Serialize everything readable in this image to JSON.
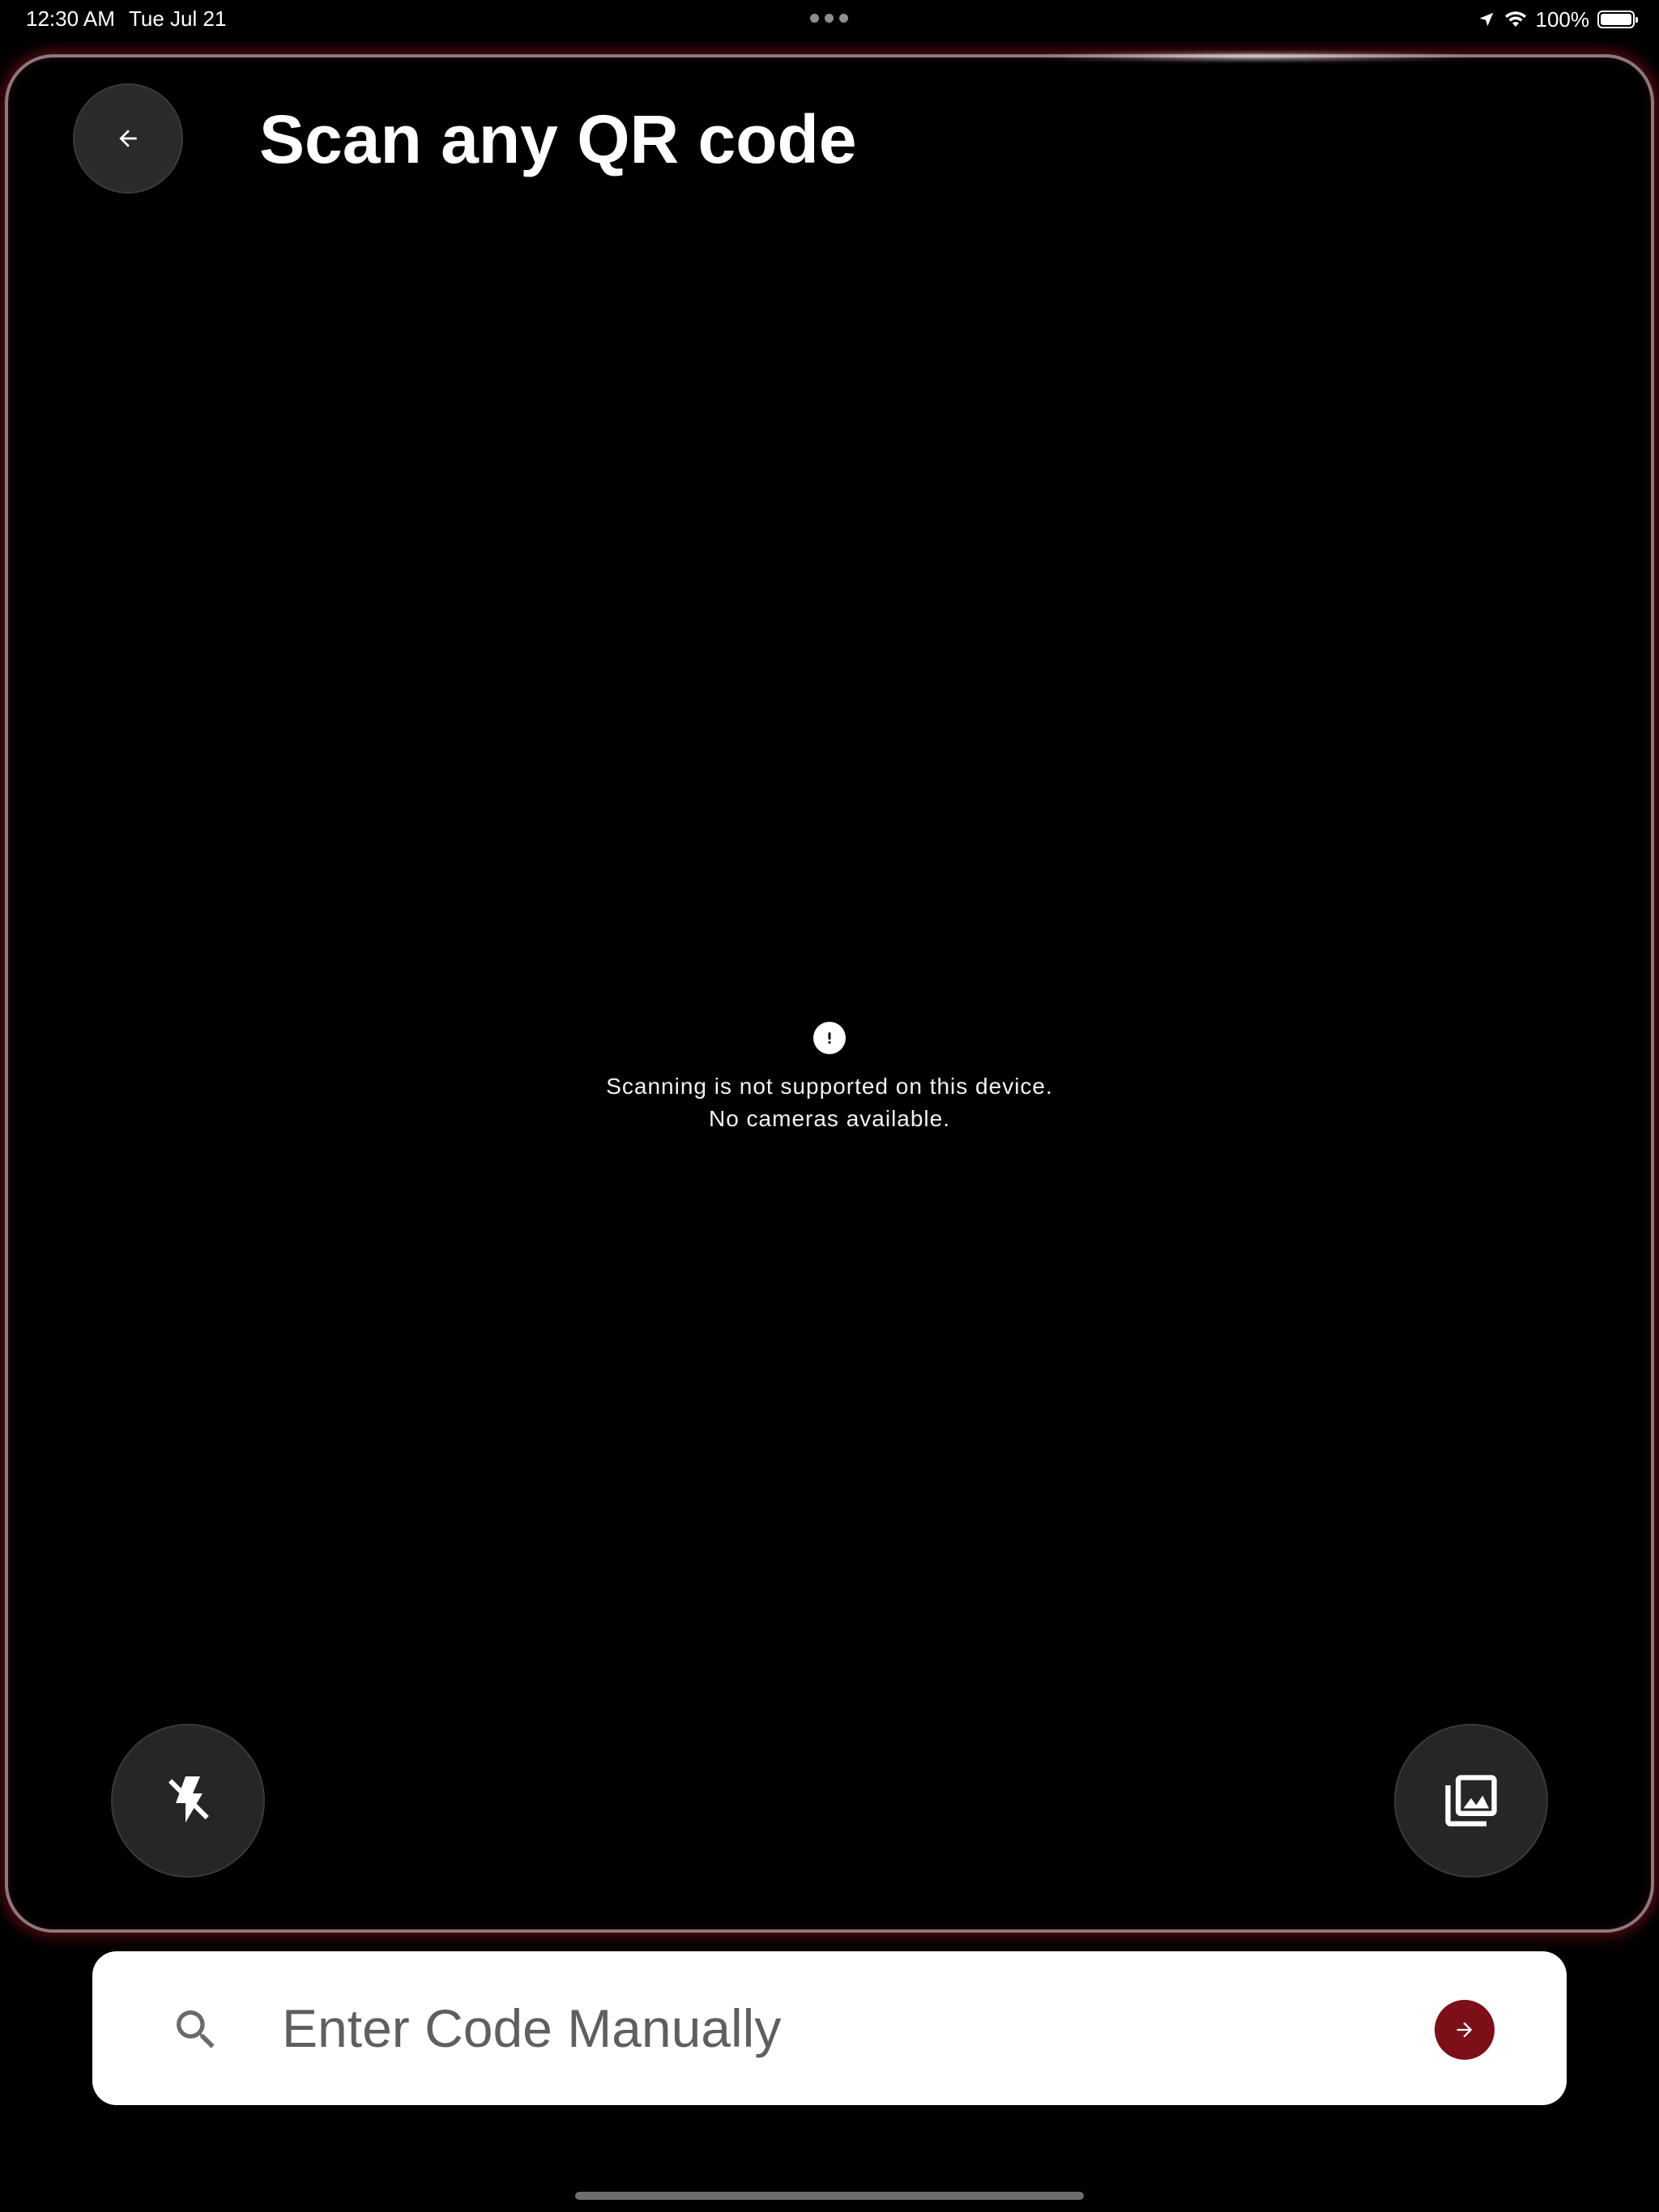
{
  "status_bar": {
    "time": "12:30 AM",
    "date": "Tue Jul 21",
    "battery_percent": "100%",
    "battery_level": 1.0,
    "icons": [
      "location-arrow-icon",
      "wifi-icon",
      "battery-icon"
    ]
  },
  "header": {
    "back_icon": "arrow-left-icon",
    "title": "Scan any QR code"
  },
  "scanner": {
    "error_icon": "exclamation-circle-icon",
    "error_line1": "Scanning is not supported on this device.",
    "error_line2": "No cameras available.",
    "flash_icon": "flash-off-icon",
    "gallery_icon": "photo-library-icon"
  },
  "manual_entry": {
    "search_icon": "search-icon",
    "placeholder": "Enter Code Manually",
    "value": "",
    "submit_icon": "arrow-right-icon"
  },
  "colors": {
    "accent": "#7d0f18",
    "background": "#000000",
    "frame_border": "#8a7a7c",
    "button_bg": "#262626"
  }
}
